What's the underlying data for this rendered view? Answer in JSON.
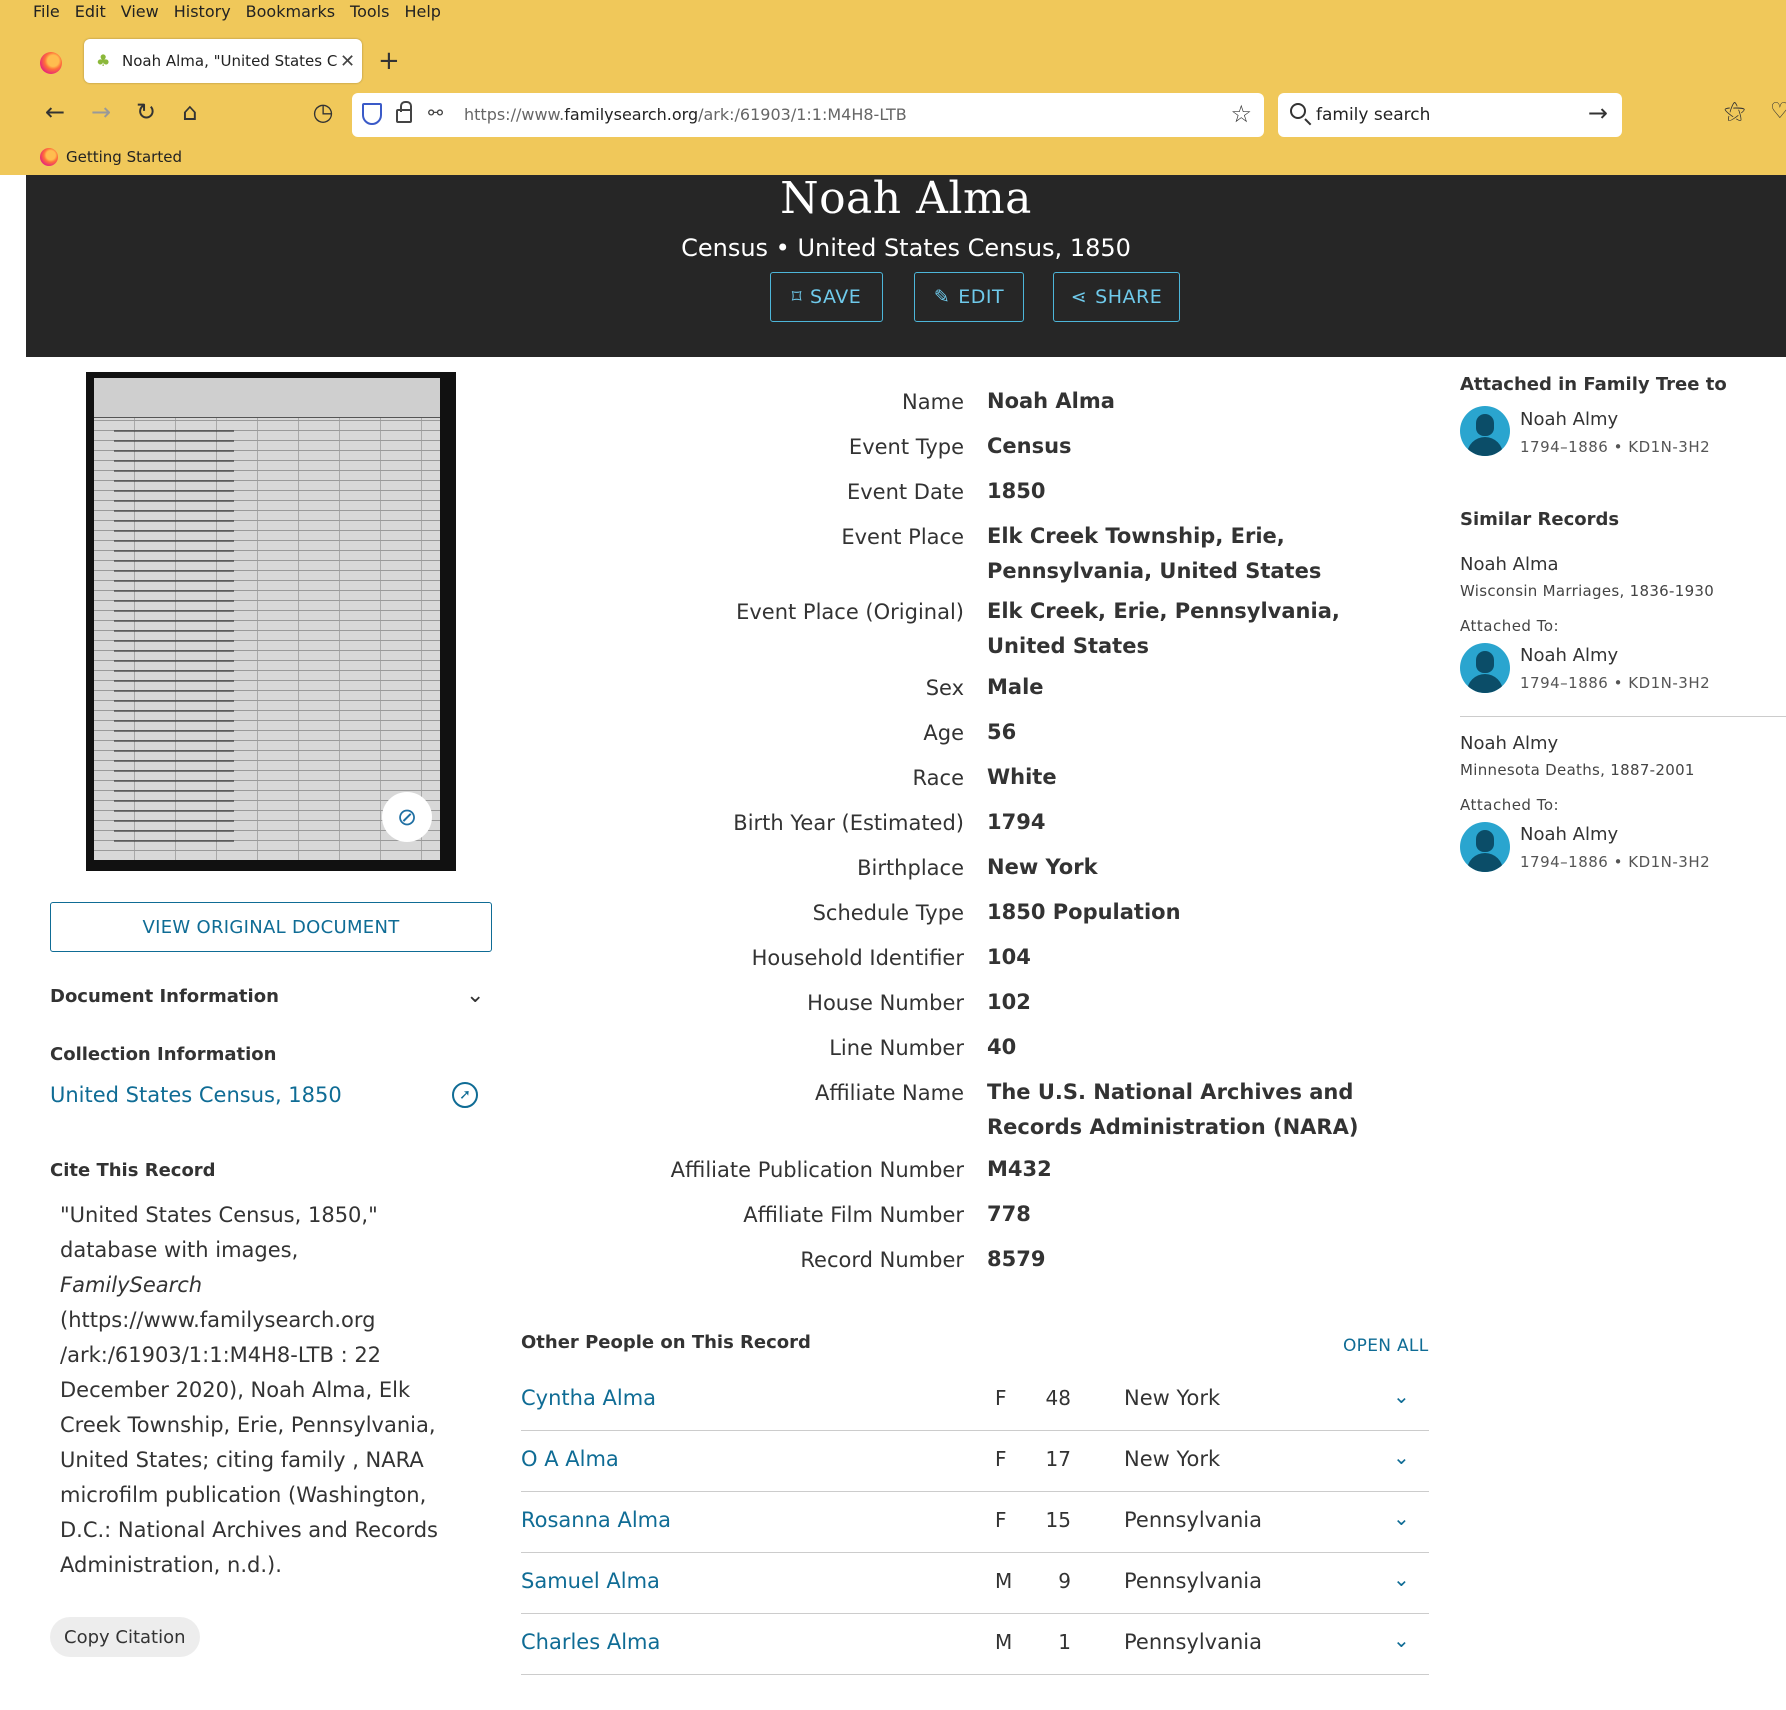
{
  "browser": {
    "menu": [
      "File",
      "Edit",
      "View",
      "History",
      "Bookmarks",
      "Tools",
      "Help"
    ],
    "tab_title": "Noah Alma, \"United States Cens",
    "url_prefix": "https://www.",
    "url_domain": "familysearch.org",
    "url_path": "/ark:/61903/1:1:M4H8-LTB",
    "search_text": "family search",
    "bookmark": "Getting Started"
  },
  "hero": {
    "name": "Noah Alma",
    "subtitle": "Census • United States Census, 1850",
    "save": "SAVE",
    "edit": "EDIT",
    "share": "SHARE"
  },
  "left": {
    "view_original": "VIEW ORIGINAL DOCUMENT",
    "doc_info": "Document Information",
    "coll_info": "Collection Information",
    "coll_link": "United States Census, 1850",
    "cite_heading": "Cite This Record",
    "cite_part1": "\"United States Census, 1850,\" database with images, ",
    "cite_italic": "FamilySearch",
    "cite_part2": " (https://www.familysearch.org /ark:/61903/1:1:M4H8-LTB : 22 December 2020), Noah Alma, Elk Creek Township, Erie, Pennsylvania, United States; citing family , NARA microfilm publication (Washington, D.C.: National Archives and Records Administration, n.d.).",
    "copy": "Copy Citation"
  },
  "facts": [
    {
      "label": "Name",
      "value": "Noah Alma"
    },
    {
      "label": "Event Type",
      "value": "Census"
    },
    {
      "label": "Event Date",
      "value": "1850"
    },
    {
      "label": "Event Place",
      "value": "Elk Creek Township, Erie, Pennsylvania, United States"
    },
    {
      "label": "Event Place (Original)",
      "value": "Elk Creek, Erie, Pennsylvania, United States"
    },
    {
      "label": "Sex",
      "value": "Male"
    },
    {
      "label": "Age",
      "value": "56"
    },
    {
      "label": "Race",
      "value": "White"
    },
    {
      "label": "Birth Year (Estimated)",
      "value": "1794"
    },
    {
      "label": "Birthplace",
      "value": "New York"
    },
    {
      "label": "Schedule Type",
      "value": "1850 Population"
    },
    {
      "label": "Household Identifier",
      "value": "104"
    },
    {
      "label": "House Number",
      "value": "102"
    },
    {
      "label": "Line Number",
      "value": "40"
    },
    {
      "label": "Affiliate Name",
      "value": "The U.S. National Archives and Records Administration (NARA)"
    },
    {
      "label": "Affiliate Publication Number",
      "value": "M432"
    },
    {
      "label": "Affiliate Film Number",
      "value": "778"
    },
    {
      "label": "Record Number",
      "value": "8579"
    }
  ],
  "others": {
    "heading": "Other People on This Record",
    "open_all": "OPEN ALL",
    "people": [
      {
        "name": "Cyntha Alma",
        "sex": "F",
        "age": "48",
        "place": "New York"
      },
      {
        "name": "O A Alma",
        "sex": "F",
        "age": "17",
        "place": "New York"
      },
      {
        "name": "Rosanna Alma",
        "sex": "F",
        "age": "15",
        "place": "Pennsylvania"
      },
      {
        "name": "Samuel Alma",
        "sex": "M",
        "age": "9",
        "place": "Pennsylvania"
      },
      {
        "name": "Charles Alma",
        "sex": "M",
        "age": "1",
        "place": "Pennsylvania"
      }
    ]
  },
  "right": {
    "attached_heading": "Attached in Family Tree to",
    "attached_name": "Noah Almy",
    "attached_meta": "1794–1886 • KD1N-3H2",
    "similar_heading": "Similar Records",
    "similar": [
      {
        "name": "Noah Alma",
        "collection": "Wisconsin Marriages, 1836-1930",
        "attached_label": "Attached To:",
        "person": "Noah Almy",
        "meta": "1794–1886 • KD1N-3H2"
      },
      {
        "name": "Noah Almy",
        "collection": "Minnesota Deaths, 1887-2001",
        "attached_label": "Attached To:",
        "person": "Noah Almy",
        "meta": "1794–1886 • KD1N-3H2"
      }
    ]
  },
  "colors": {
    "chrome": "#f0c85a",
    "hero": "#262626",
    "link": "#0f6c95",
    "hero_button": "#6fcaeb"
  }
}
